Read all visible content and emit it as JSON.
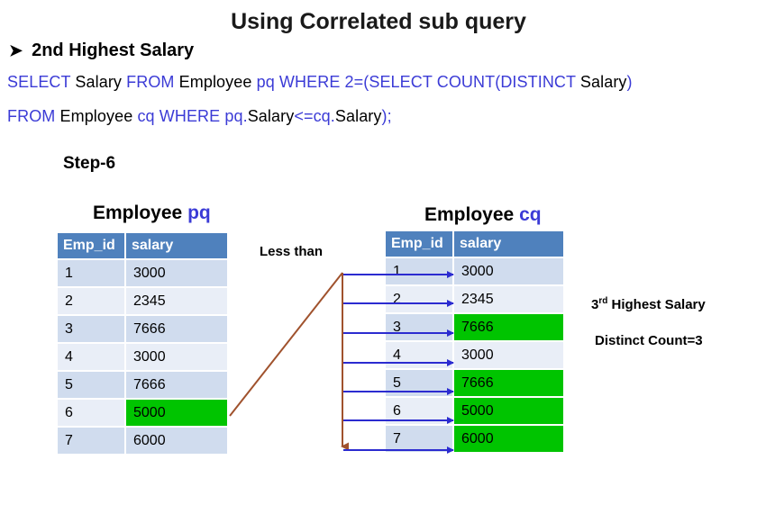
{
  "title": "Using Correlated sub query",
  "subheading": "2nd Highest Salary",
  "query": {
    "line1": [
      {
        "text": "SELECT ",
        "kw": true
      },
      {
        "text": "Salary ",
        "kw": false
      },
      {
        "text": "FROM ",
        "kw": true
      },
      {
        "text": "Employee ",
        "kw": false
      },
      {
        "text": "pq ",
        "kw": true
      },
      {
        "text": "WHERE 2=(SELECT COUNT(DISTINCT ",
        "kw": true
      },
      {
        "text": "Salary",
        "kw": false
      },
      {
        "text": ")",
        "kw": true
      }
    ],
    "line2": [
      {
        "text": "FROM ",
        "kw": true
      },
      {
        "text": "Employee ",
        "kw": false
      },
      {
        "text": "cq ",
        "kw": true
      },
      {
        "text": "WHERE ",
        "kw": true
      },
      {
        "text": "pq.",
        "kw": true
      },
      {
        "text": "Salary",
        "kw": false
      },
      {
        "text": "<=",
        "kw": true
      },
      {
        "text": "cq.",
        "kw": true
      },
      {
        "text": "Salary",
        "kw": false
      },
      {
        "text": ");",
        "kw": true
      }
    ]
  },
  "step_label": "Step-6",
  "left_table": {
    "caption": "Employee",
    "alias": "pq",
    "headers": [
      "Emp_id",
      "salary"
    ],
    "rows": [
      {
        "id": "1",
        "salary": "3000",
        "highlight": false
      },
      {
        "id": "2",
        "salary": "2345",
        "highlight": false
      },
      {
        "id": "3",
        "salary": "7666",
        "highlight": false
      },
      {
        "id": "4",
        "salary": "3000",
        "highlight": false
      },
      {
        "id": "5",
        "salary": "7666",
        "highlight": false
      },
      {
        "id": "6",
        "salary": "5000",
        "highlight": true
      },
      {
        "id": "7",
        "salary": "6000",
        "highlight": false
      }
    ]
  },
  "right_table": {
    "caption": "Employee",
    "alias": "cq",
    "headers": [
      "Emp_id",
      "salary"
    ],
    "rows": [
      {
        "id": "1",
        "salary": "3000",
        "highlight": false
      },
      {
        "id": "2",
        "salary": "2345",
        "highlight": false
      },
      {
        "id": "3",
        "salary": "7666",
        "highlight": true
      },
      {
        "id": "4",
        "salary": "3000",
        "highlight": false
      },
      {
        "id": "5",
        "salary": "7666",
        "highlight": true
      },
      {
        "id": "6",
        "salary": "5000",
        "highlight": true
      },
      {
        "id": "7",
        "salary": "6000",
        "highlight": true
      }
    ]
  },
  "connector_label": "Less than",
  "notes": {
    "rank_num": "3",
    "rank_sup": "rd",
    "rank_text": " Highest Salary",
    "distinct_count": "Distinct Count=3"
  },
  "colors": {
    "keyword": "#3b3bd6",
    "header_bg": "#4f81bd",
    "row_odd": "#d0dcee",
    "row_even": "#e9eef7",
    "highlight": "#00c400",
    "connector": "#a0522d",
    "arrow": "#2b2bd0"
  }
}
